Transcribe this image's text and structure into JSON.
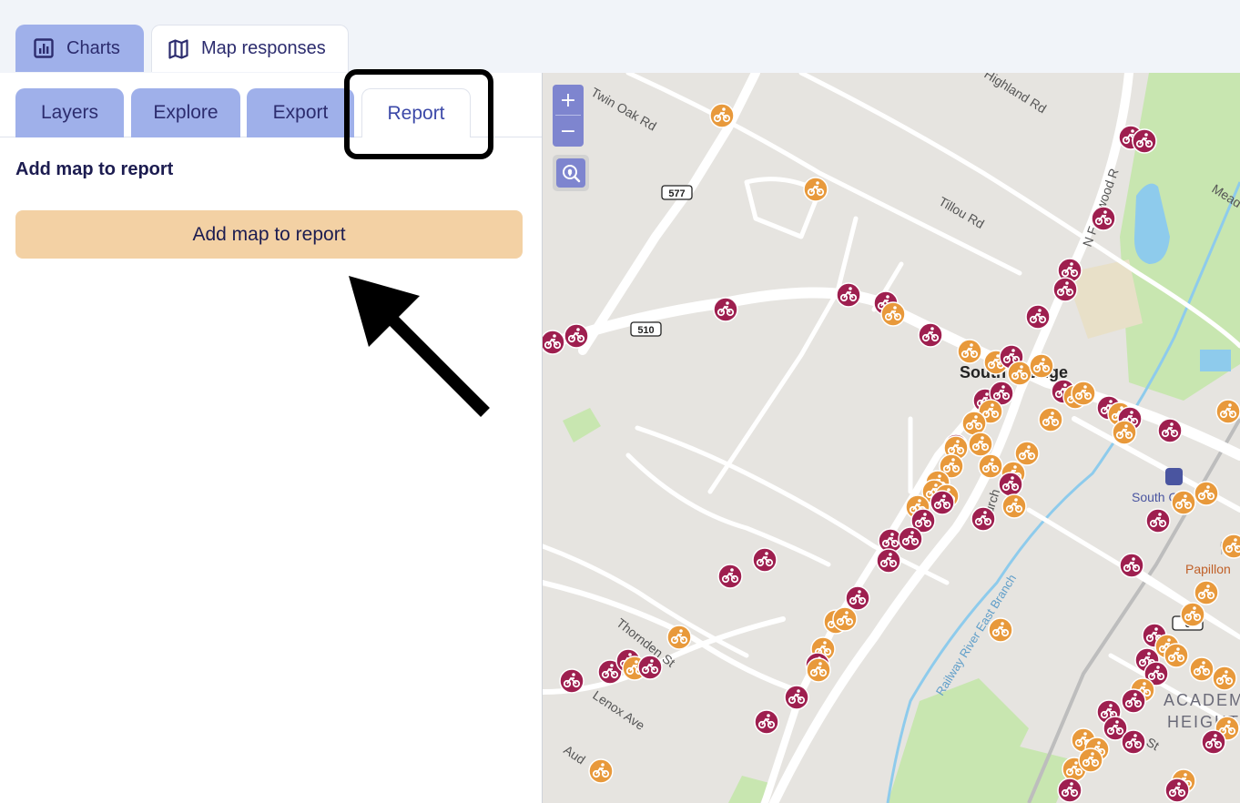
{
  "main_tabs": {
    "charts": "Charts",
    "map_responses": "Map responses"
  },
  "sub_tabs": {
    "layers": "Layers",
    "explore": "Explore",
    "export": "Export",
    "report": "Report"
  },
  "report_panel": {
    "title": "Add map to report",
    "button": "Add map to report"
  },
  "map": {
    "zoom_in": "+",
    "zoom_out": "−",
    "streets": {
      "twin_oak": "Twin Oak Rd",
      "highland": "Highland Rd",
      "tillou": "Tillou Rd",
      "fernwood": "N Fernwood R",
      "mead": "Mead",
      "thornden": "Thornden St",
      "lenox": "Lenox Ave",
      "audley": "Aud",
      "railway_river": "Railway River East Branch",
      "church": "urch",
      "st": "St"
    },
    "route_shields": {
      "r577": "577",
      "r510": "510",
      "r6": "6"
    },
    "places": {
      "south_orange": "South Orange",
      "station": "South O",
      "papillon": "Papillon",
      "academy1": "ACADEM",
      "academy2": "HEIGHT"
    },
    "colors": {
      "marker_orange": "#e8993b",
      "marker_maroon": "#9e1f4f",
      "park": "#c8e6b0",
      "water": "#8ecbec"
    }
  }
}
